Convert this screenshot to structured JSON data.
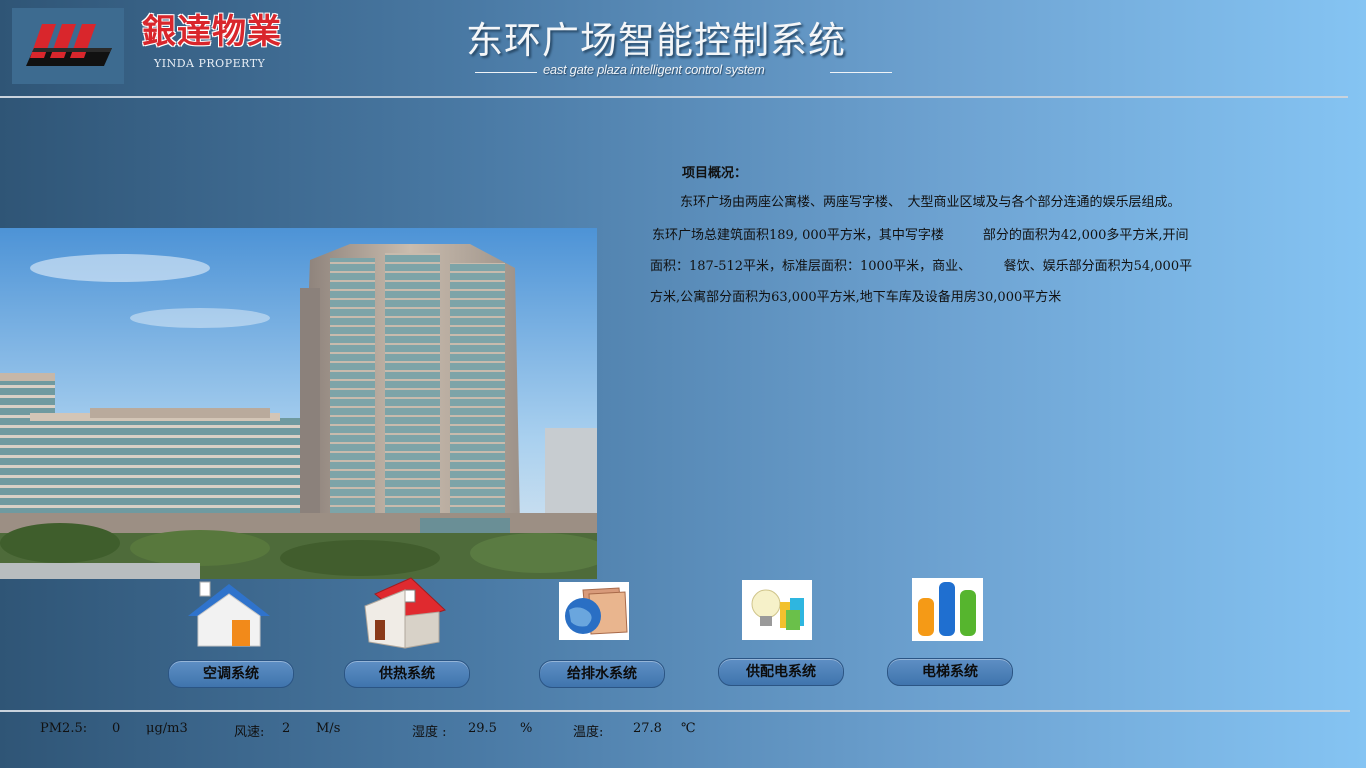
{
  "header": {
    "brand_cn": "銀達物業",
    "brand_en": "YINDA PROPERTY",
    "title": "东环广场智能控制系统",
    "subtitle": "east gate plaza intelligent control system"
  },
  "overview": {
    "title": "项目概况：",
    "lines": [
      "东环广场由两座公寓楼、两座写字楼、　大型商业区域及与各个部分连通的娱乐层组成。",
      "东环广场总建筑面积189, 000平方米，其中写字楼　　　部分的面积为42,000多平方米,开间",
      "面积：187-512平米，标准层面积：1000平米，商业、　　　餐饮、娱乐部分面积为54,000平",
      "方米,公寓部分面积为63,000平方米,地下车库及设备用房30,000平方米"
    ]
  },
  "systems": [
    {
      "label": "空调系统",
      "icon": "house-blue-roof-icon"
    },
    {
      "label": "供热系统",
      "icon": "house-red-roof-icon"
    },
    {
      "label": "给排水系统",
      "icon": "globe-folder-icon"
    },
    {
      "label": "供配电系统",
      "icon": "lightbulb-icon"
    },
    {
      "label": "电梯系统",
      "icon": "bar-chart-icon"
    }
  ],
  "environment": {
    "pm25_label": "PM2.5:",
    "pm25_value": "0",
    "pm25_unit": "μg/m3",
    "wind_label": "风速:",
    "wind_value": "2",
    "wind_unit": "M/s",
    "humidity_label": "湿度 :",
    "humidity_value": "29.5",
    "humidity_unit": "%",
    "temp_label": "温度:",
    "temp_value": "27.8",
    "temp_unit": "℃"
  },
  "colors": {
    "brand_red": "#d9262c",
    "button_blue": "#4a7db5"
  }
}
